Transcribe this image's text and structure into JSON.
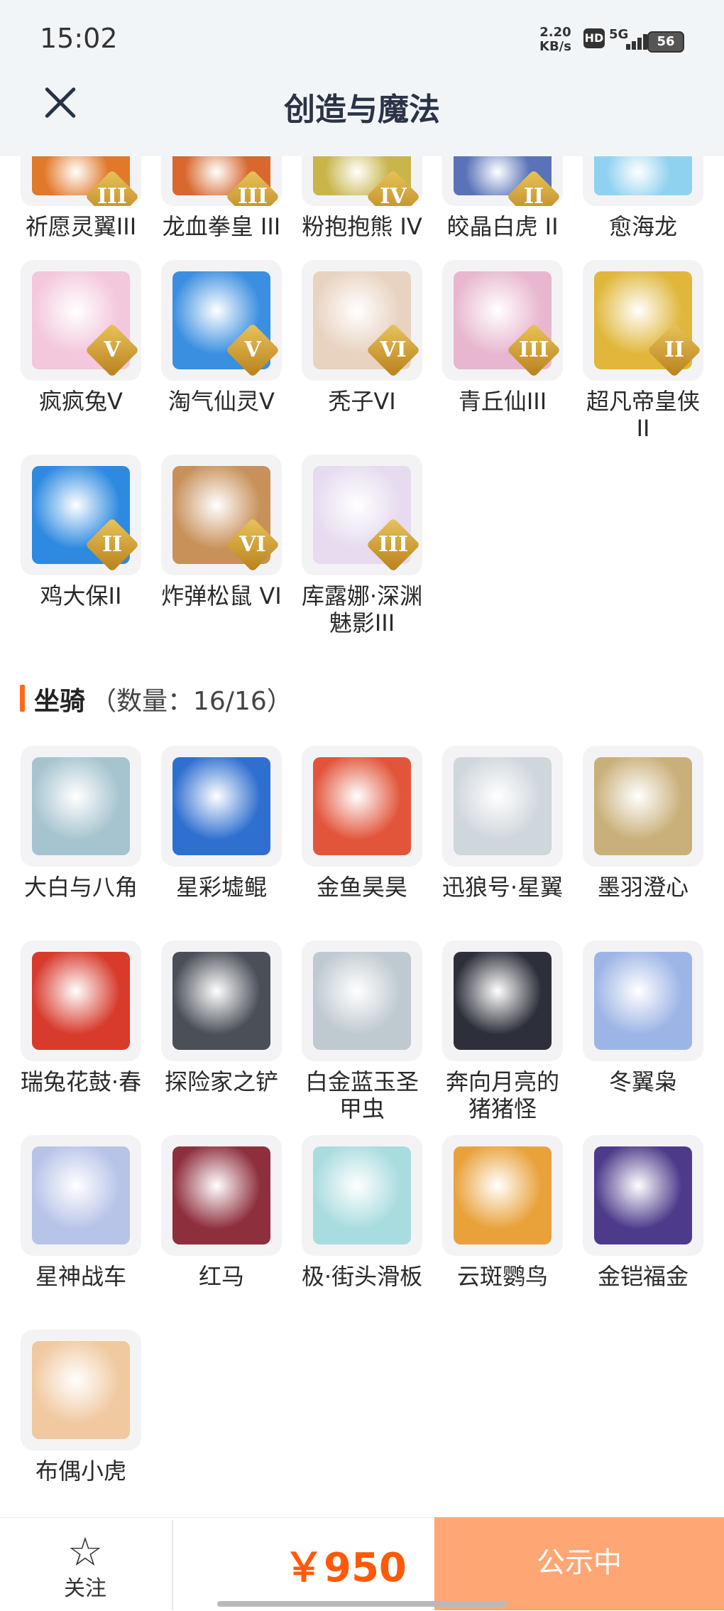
{
  "status_bar": {
    "time": "15:02",
    "speed_value": "2.20",
    "speed_unit": "KB/s",
    "hd": "HD",
    "network": "5G",
    "battery": "56"
  },
  "header": {
    "title": "创造与魔法"
  },
  "pets_top": [
    {
      "label": "祈愿灵翼III",
      "rank": "III",
      "color": "#e2792a"
    },
    {
      "label": "龙血拳皇 III",
      "rank": "III",
      "color": "#d8682e"
    },
    {
      "label": "粉抱抱熊 IV",
      "rank": "IV",
      "color": "#c9b54a"
    },
    {
      "label": "皎晶白虎 II",
      "rank": "II",
      "color": "#5a73b8"
    },
    {
      "label": "愈海龙",
      "rank": "",
      "color": "#8fd2f0"
    }
  ],
  "pets_rows": [
    {
      "label": "疯疯兔V",
      "rank": "V",
      "color": "#f3c7dc"
    },
    {
      "label": "淘气仙灵V",
      "rank": "V",
      "color": "#3b8fe0"
    },
    {
      "label": "秃子VI",
      "rank": "VI",
      "color": "#e8d2c0"
    },
    {
      "label": "青丘仙III",
      "rank": "III",
      "color": "#e8b7cf"
    },
    {
      "label": "超凡帝皇侠II",
      "rank": "II",
      "color": "#e0b73a"
    },
    {
      "label": "鸡大保II",
      "rank": "II",
      "color": "#2d8ae0"
    },
    {
      "label": "炸弹松鼠 VI",
      "rank": "VI",
      "color": "#c8915a"
    },
    {
      "label": "库露娜·深渊魅影III",
      "rank": "III",
      "color": "#e6dbef"
    }
  ],
  "mount_section": {
    "name": "坐骑",
    "count": "（数量：16/16）"
  },
  "mounts": [
    {
      "label": "大白与八角",
      "color": "#a6c4cf"
    },
    {
      "label": "星彩墟鲲",
      "color": "#2f6fd0"
    },
    {
      "label": "金鱼昊昊",
      "color": "#e2553b"
    },
    {
      "label": "迅狼号·星翼",
      "color": "#cfd6dc"
    },
    {
      "label": "墨羽澄心",
      "color": "#c9b07a"
    },
    {
      "label": "瑞兔花鼓·春",
      "color": "#d83a2c"
    },
    {
      "label": "探险家之铲",
      "color": "#4a4f58"
    },
    {
      "label": "白金蓝玉圣甲虫",
      "color": "#bfc9d0"
    },
    {
      "label": "奔向月亮的猪猪怪",
      "color": "#2d2f3a"
    },
    {
      "label": "冬翼枭",
      "color": "#9db5e6"
    },
    {
      "label": "星神战车",
      "color": "#b8c3e8"
    },
    {
      "label": "红马",
      "color": "#8e2f3e"
    },
    {
      "label": "极·街头滑板",
      "color": "#a9dcdf"
    },
    {
      "label": "云斑鹦鸟",
      "color": "#e9a23a"
    },
    {
      "label": "金铠福金",
      "color": "#4d3a8a"
    },
    {
      "label": "布偶小虎",
      "color": "#f0c9a0"
    }
  ],
  "bottom": {
    "follow_label": "关注",
    "price": "￥950",
    "status_label": "公示中"
  }
}
